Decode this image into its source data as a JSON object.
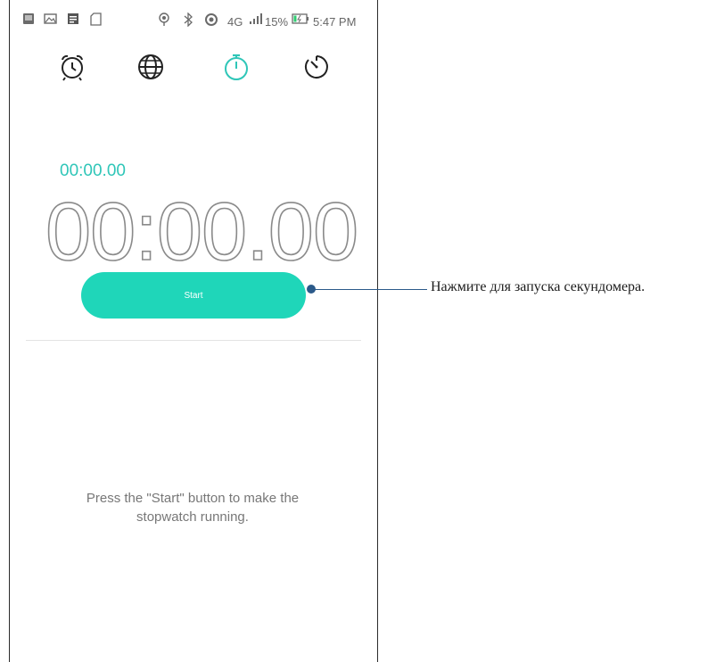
{
  "status_bar": {
    "network": "4G",
    "battery_percent": "15%",
    "time": "5:47 PM",
    "icons": [
      "gallery-icon",
      "image-icon",
      "notes-icon",
      "sd-card-icon",
      "location-icon",
      "bluetooth-icon",
      "sync-icon",
      "signal-icon",
      "battery-icon"
    ]
  },
  "tabs": [
    {
      "name": "alarm-icon",
      "active": false
    },
    {
      "name": "world-clock-icon",
      "active": false
    },
    {
      "name": "stopwatch-icon",
      "active": true
    },
    {
      "name": "timer-icon",
      "active": false
    }
  ],
  "stopwatch": {
    "lap_time": "00:00.00",
    "main_time": "00:00.00",
    "start_label": "Start"
  },
  "hint": {
    "line1": "Press the \"Start\" button to make the",
    "line2": "stopwatch running."
  },
  "annotation": {
    "text": "Нажмите для запуска секундомера."
  },
  "colors": {
    "accent": "#1fd6b9",
    "lap_text": "#2fc6b8",
    "callout": "#2b5a8a"
  }
}
